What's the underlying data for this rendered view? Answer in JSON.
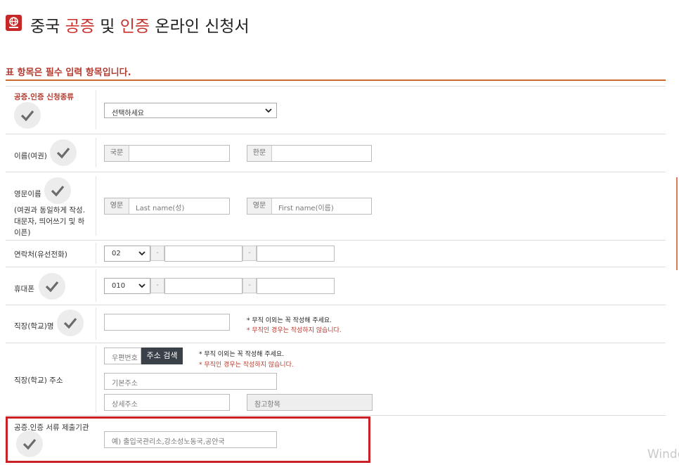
{
  "header": {
    "title_part1": "중국 ",
    "title_hl1": "공증",
    "title_mid": " 및 ",
    "title_hl2": "인증",
    "title_end": " 온라인 신청서",
    "subtitle": "표 항목은 필수 입력 항목입니다.",
    "accent_color": "#c9302c"
  },
  "rows": {
    "type": {
      "label": "공증.인증 신청종류",
      "select_value": "선택하세요"
    },
    "name": {
      "label": "이름(여권)",
      "addon1": "국문",
      "addon2": "한문"
    },
    "english_name": {
      "label": "영문이름",
      "help": "(여권과 동일하게 작성. 대문자, 띄어쓰기 및 하이픈)",
      "addon1": "영문",
      "placeholder1": "Last name(성)",
      "addon2": "영문",
      "placeholder2": "First name(이름)"
    },
    "landline": {
      "label": "연락처(유선전화)",
      "prefix": "02",
      "dash": "-"
    },
    "mobile": {
      "label": "휴대폰",
      "prefix": "010",
      "dash": "-"
    },
    "workplace": {
      "label": "직장(학교)명",
      "note1": "* 무직 이외는 꼭 작성해 주세요.",
      "note2": "* 무직인 경우는 작성하지 않습니다."
    },
    "address": {
      "label": "직장(학교) 주소",
      "zip": "우편번호",
      "search_button": "주소 검색",
      "note1": "* 무직 이외는 꼭 작성해 주세요.",
      "note2": "* 무직인 경우는 작성하지 않습니다.",
      "basic": "기본주소",
      "detail": "상세주소",
      "reference": "참고항목"
    },
    "institution": {
      "label": "공증.인증 서류 제출기관",
      "placeholder": "예) 출입국관리소,강소성노동국,공안국"
    }
  },
  "watermark": "Windo"
}
